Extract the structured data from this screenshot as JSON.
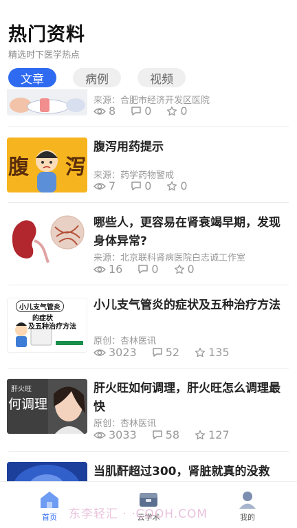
{
  "header": {
    "title": "热门资料",
    "subtitle": "精选时下医学热点"
  },
  "tabs": [
    {
      "label": "文章",
      "active": true
    },
    {
      "label": "病例",
      "active": false
    },
    {
      "label": "视频",
      "active": false
    }
  ],
  "articles": [
    {
      "title": "",
      "source": "来源：合肥市经济开发区医院",
      "views": "8",
      "comments": "0",
      "likes": "0"
    },
    {
      "title": "腹泻用药提示",
      "source": "来源：药学药物警戒",
      "views": "7",
      "comments": "0",
      "likes": "0",
      "thumb_text_left": "腹",
      "thumb_text_right": "泻"
    },
    {
      "title": "哪些人，更容易在肾衰竭早期，发现身体异常?",
      "source": "来源：北京联科肾病医院白志诚工作室",
      "views": "16",
      "comments": "0",
      "likes": "0"
    },
    {
      "title": "小儿支气管炎的症状及五种治疗方法",
      "source": "原创：杏林医讯",
      "views": "3023",
      "comments": "52",
      "likes": "135",
      "thumb_line1": "小儿支气管炎",
      "thumb_line2": "的症状",
      "thumb_line3": "及五种治疗方法"
    },
    {
      "title": "肝火旺如何调理，肝火旺怎么调理最快",
      "source": "原创：杏林医讯",
      "views": "3033",
      "comments": "58",
      "likes": "127",
      "thumb_line1": "肝火旺",
      "thumb_line2": "何调理"
    },
    {
      "title": "当肌酐超过300，肾脏就真的没救",
      "source": "",
      "views": "",
      "comments": "",
      "likes": ""
    }
  ],
  "bottom_nav": [
    {
      "label": "首页",
      "icon": "home-icon",
      "active": true
    },
    {
      "label": "云学术",
      "icon": "academic-icon",
      "active": false
    },
    {
      "label": "我的",
      "icon": "profile-icon",
      "active": false
    }
  ],
  "watermark": "东李轻汇 ·  ·COOH.COM",
  "colors": {
    "accent": "#2f6bf0",
    "meta": "#999999",
    "title": "#222222"
  }
}
